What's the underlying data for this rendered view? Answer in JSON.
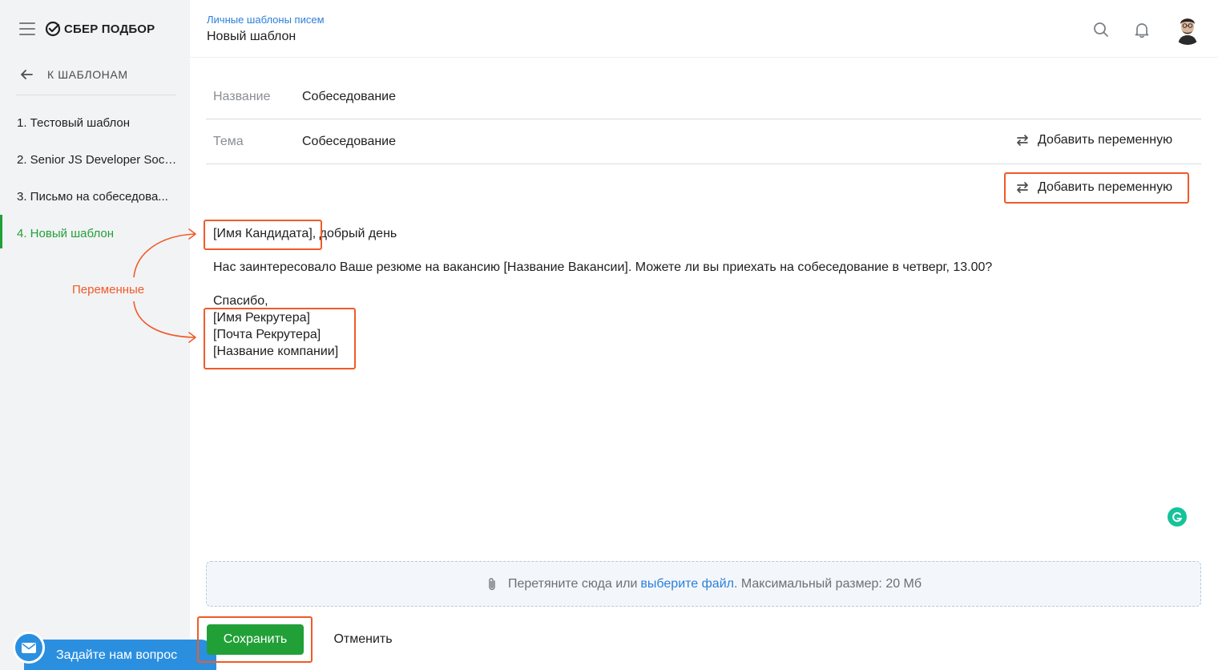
{
  "app": {
    "logo_text": "СБЕР ПОДБОР"
  },
  "sidebar": {
    "back_label": "К ШАБЛОНАМ",
    "items": [
      {
        "label": "1. Тестовый шаблон"
      },
      {
        "label": "2. Senior JS Developer Soci..."
      },
      {
        "label": "3. Письмо на собеседова..."
      },
      {
        "label": "4. Новый шаблон"
      }
    ],
    "active_index": 3,
    "annotation": "Переменные"
  },
  "header": {
    "breadcrumb": "Личные шаблоны писем",
    "title": "Новый шаблон"
  },
  "form": {
    "name_label": "Название",
    "name_value": "Собеседование",
    "subject_label": "Тема",
    "subject_value": "Собеседование",
    "add_variable_label": "Добавить переменную",
    "add_variable_body_label": "Добавить переменную"
  },
  "body": {
    "greeting_var": "[Имя Кандидата]",
    "greeting_rest": ", добрый день",
    "paragraph": "Нас заинтересовало Ваше резюме на вакансию [Название Вакансии]. Можете ли вы приехать на собеседование в четверг, 13.00?",
    "thanks": "Спасибо,",
    "sig_name": "[Имя Рекрутера]",
    "sig_email": "[Почта Рекрутера]",
    "sig_company": "[Название компании]"
  },
  "attachments": {
    "text_before": "Перетяните сюда или",
    "link": "выберите файл",
    "text_after": ". Максимальный размер: 20 Мб"
  },
  "actions": {
    "save": "Сохранить",
    "cancel": "Отменить"
  },
  "help": {
    "label": "Задайте нам вопрос"
  },
  "colors": {
    "accent_green": "#21a038",
    "link_blue": "#2b7fd9",
    "annotation_orange": "#f05a28"
  }
}
